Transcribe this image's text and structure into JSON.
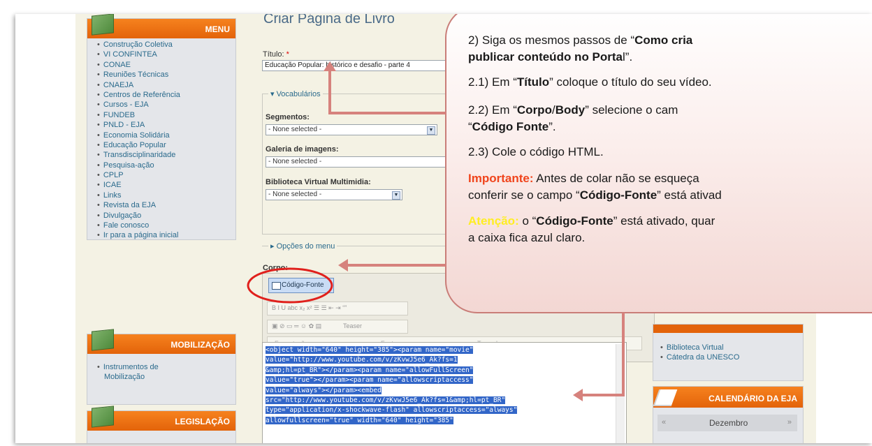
{
  "sidebar": {
    "menu_title": "MENU",
    "menu_items": [
      "Construção Coletiva",
      "VI CONFINTEA",
      "CONAE",
      "Reuniões Técnicas",
      "CNAEJA",
      "Centros de Referência",
      "Cursos - EJA",
      "FUNDEB",
      "PNLD - EJA",
      "Economia Solidária",
      "Educação Popular",
      "Transdisciplinaridade",
      "Pesquisa-ação",
      "CPLP",
      "ICAE",
      "Links",
      "Revista da EJA",
      "Divulgação",
      "Fale conosco",
      "Ir para a página inicial"
    ],
    "mobilizacao_title": "MOBILIZAÇÃO",
    "mobilizacao_items": [
      "Instrumentos de",
      "Mobilização"
    ],
    "legislacao_title": "LEGISLAÇÃO"
  },
  "form": {
    "page_title": "Criar Página de Livro",
    "titulo_label": "Título:",
    "titulo_required": "*",
    "titulo_value": "Educação Popular: histórico e desafio - parte 4",
    "vocab_legend": "▾ Vocabulários",
    "segmentos_label": "Segmentos:",
    "segmentos_value": "- None selected -",
    "galeria_label": "Galeria de imagens:",
    "galeria_value": "- None selected -",
    "biblioteca_label": "Biblioteca Virtual Multimidia:",
    "biblioteca_value": "- None selected -",
    "menu_options": "▸ Opções do menu",
    "corpo_label": "Corpo:",
    "source_button": "Código-Fonte",
    "teaser": "Teaser",
    "formatacao": "Formatação",
    "fonte": "Fonte",
    "tamanho": "Tamanho",
    "code_lines": [
      "<object width=\"640\" height=\"385\"><param name=\"movie\"",
      "value=\"http://www.youtube.com/v/zKvwJ5e6_Ak?fs=1",
      "&amp;hl=pt_BR\"></param><param name=\"allowFullScreen\"",
      "value=\"true\"></param><param name=\"allowscriptaccess\"",
      "value=\"always\"></param><embed",
      "src=\"http://www.youtube.com/v/zKvwJ5e6_Ak?fs=1&amp;hl=pt_BR\"",
      "type=\"application/x-shockwave-flash\" allowscriptaccess=\"always\"",
      "allowfullscreen=\"true\" width=\"640\" height=\"385\""
    ]
  },
  "right": {
    "items": [
      "Biblioteca Virtual",
      "Cátedra da UNESCO"
    ],
    "calendar_title": "CALENDÁRIO DA EJA",
    "calendar_month": "Dezembro",
    "calendar_prev": "«",
    "calendar_next": "»"
  },
  "callout": {
    "l1a": "2) Siga os mesmos passos de “",
    "l1b": "Como cria",
    "l2a": "publicar conteúdo no Porta",
    "l2b": "l”.",
    "l3a": "2.1) Em “",
    "l3b": "Título",
    "l3c": "” coloque o título do seu vídeo.",
    "l4a": "2.2)  Em  “",
    "l4b": "Corpo",
    "l4c": "/",
    "l4d": "Body",
    "l4e": "”  selecione  o  cam",
    "l5a": "“",
    "l5b": "Código Fonte",
    "l5c": "”.",
    "l6": "2.3) Cole o código HTML.",
    "l7a": "Importante:",
    "l7b": " Antes de colar não se esqueça",
    "l8a": "conferir se o campo “",
    "l8b": "Código-Fonte",
    "l8c": "” está ativad",
    "l9a": "Atenção:",
    "l9b": " o “",
    "l9c": "Código-Fonte",
    "l9d": "” está ativado, quar",
    "l10": "a caixa fica azul claro."
  },
  "colors": {
    "orange_header": "#f6821e",
    "callout_border": "#c97d78",
    "arrow": "#d6827d",
    "highlight_ellipse": "#e0201c",
    "selection_blue": "#3266c8"
  }
}
